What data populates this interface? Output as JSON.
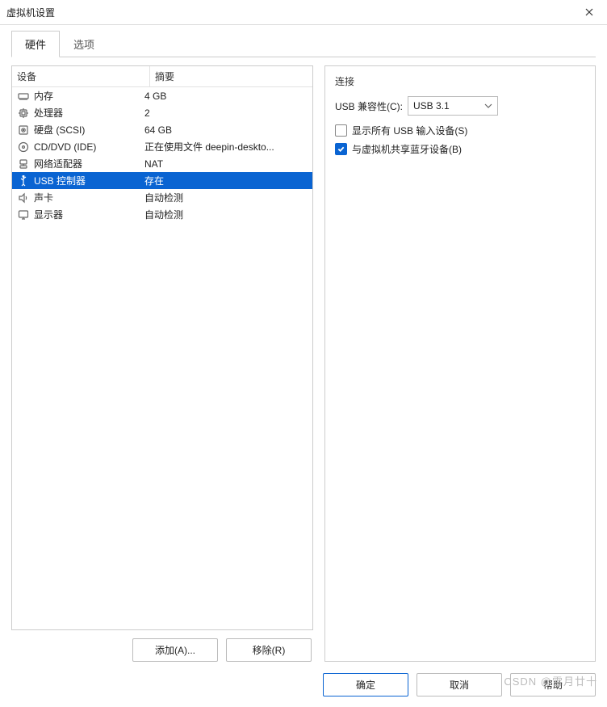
{
  "window": {
    "title": "虚拟机设置"
  },
  "tabs": {
    "hardware": "硬件",
    "options": "选项"
  },
  "device_table": {
    "head_device": "设备",
    "head_summary": "摘要",
    "rows": [
      {
        "icon": "memory-icon",
        "name": "内存",
        "summary": "4 GB",
        "sel": false
      },
      {
        "icon": "cpu-icon",
        "name": "处理器",
        "summary": "2",
        "sel": false
      },
      {
        "icon": "disk-icon",
        "name": "硬盘 (SCSI)",
        "summary": "64 GB",
        "sel": false
      },
      {
        "icon": "cd-icon",
        "name": "CD/DVD (IDE)",
        "summary": "正在使用文件 deepin-deskto...",
        "sel": false
      },
      {
        "icon": "network-icon",
        "name": "网络适配器",
        "summary": "NAT",
        "sel": false
      },
      {
        "icon": "usb-icon",
        "name": "USB 控制器",
        "summary": "存在",
        "sel": true
      },
      {
        "icon": "sound-icon",
        "name": "声卡",
        "summary": "自动检测",
        "sel": false
      },
      {
        "icon": "display-icon",
        "name": "显示器",
        "summary": "自动检测",
        "sel": false
      }
    ]
  },
  "left_buttons": {
    "add": "添加(A)...",
    "remove": "移除(R)"
  },
  "right_panel": {
    "group": "连接",
    "compat_label": "USB 兼容性(C):",
    "compat_value": "USB 3.1",
    "cb_show_all": "显示所有 USB 输入设备(S)",
    "cb_share_bt": "与虚拟机共享蓝牙设备(B)",
    "cb_show_all_checked": false,
    "cb_share_bt_checked": true
  },
  "footer": {
    "ok": "确定",
    "cancel": "取消",
    "help": "帮助"
  },
  "watermark": "CSDN @雪月廿十"
}
